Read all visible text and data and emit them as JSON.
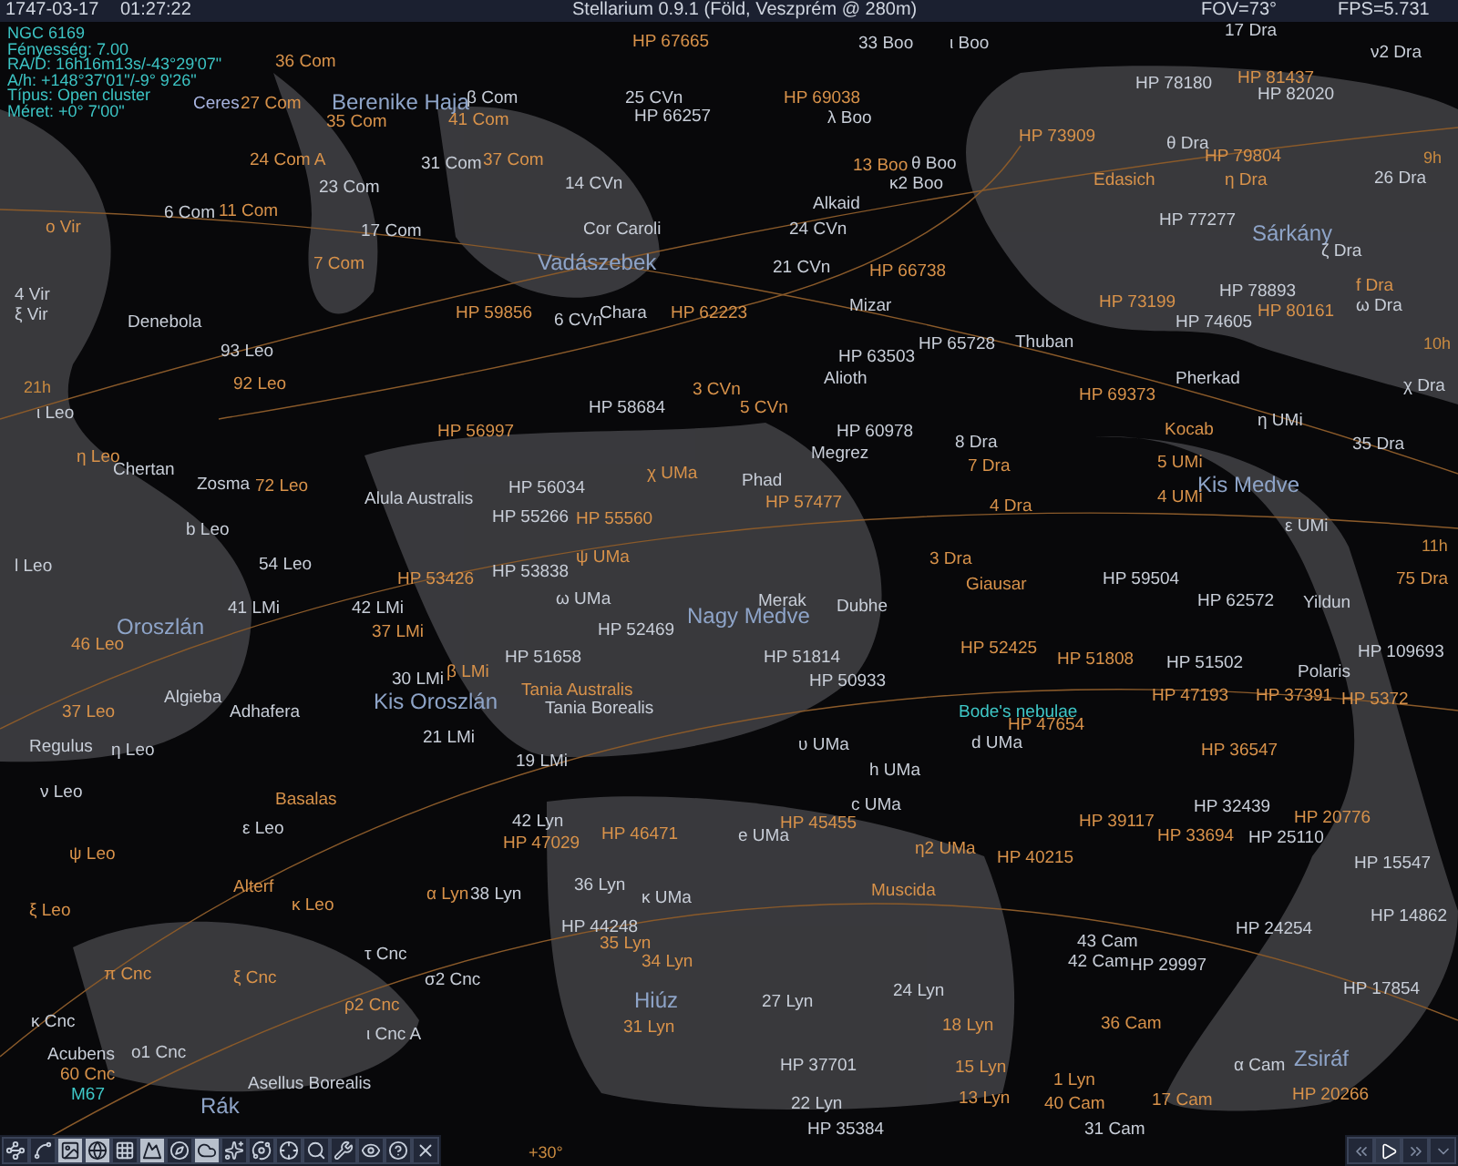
{
  "top_bar": {
    "date": "1747-03-17",
    "time": "01:27:22",
    "title": "Stellarium 0.9.1 (Föld, Veszprém @ 280m)",
    "fov": "FOV=73°",
    "fps": "FPS=5.731"
  },
  "info": [
    "NGC 6169",
    "Fényesség: 7.00",
    "RA/D: 16h16m13s/-43°29'07\"",
    "A/h: +148°37'01\"/-9° 9'26\"",
    "Típus: Open cluster",
    "Méret: +0° 7'00\""
  ],
  "labels": [
    {
      "text": "36 Com",
      "kind": "faint"
    },
    {
      "text": "Ceres",
      "kind": "planet"
    },
    {
      "text": "27 Com",
      "kind": "faint"
    },
    {
      "text": "Berenike Haja",
      "kind": "constellation"
    },
    {
      "text": "35 Com",
      "kind": "faint"
    },
    {
      "text": "β Com",
      "kind": "star"
    },
    {
      "text": "41 Com",
      "kind": "faint"
    },
    {
      "text": "HP 67665",
      "kind": "faint"
    },
    {
      "text": "25 CVn",
      "kind": "star"
    },
    {
      "text": "HP 66257",
      "kind": "star"
    },
    {
      "text": "24 Com A",
      "kind": "faint"
    },
    {
      "text": "31 Com",
      "kind": "star"
    },
    {
      "text": "37 Com",
      "kind": "faint"
    },
    {
      "text": "23 Com",
      "kind": "star"
    },
    {
      "text": "14 CVn",
      "kind": "star"
    },
    {
      "text": "6 Com",
      "kind": "star"
    },
    {
      "text": "11 Com",
      "kind": "faint"
    },
    {
      "text": "o Vir",
      "kind": "faint"
    },
    {
      "text": "17 Com",
      "kind": "star"
    },
    {
      "text": "Cor Caroli",
      "kind": "star"
    },
    {
      "text": "7 Com",
      "kind": "faint"
    },
    {
      "text": "Vadászebek",
      "kind": "constellation"
    },
    {
      "text": "4 Vir",
      "kind": "star"
    },
    {
      "text": "ξ Vir",
      "kind": "star"
    },
    {
      "text": "Denebola",
      "kind": "star"
    },
    {
      "text": "HP 59856",
      "kind": "faint"
    },
    {
      "text": "6 CVn",
      "kind": "star"
    },
    {
      "text": "Chara",
      "kind": "star"
    },
    {
      "text": "HP 62223",
      "kind": "faint"
    },
    {
      "text": "93 Leo",
      "kind": "star"
    },
    {
      "text": "33 Boo",
      "kind": "star"
    },
    {
      "text": "ι Boo",
      "kind": "star"
    },
    {
      "text": "17 Dra",
      "kind": "star"
    },
    {
      "text": "ν2 Dra",
      "kind": "star"
    },
    {
      "text": "HP 69038",
      "kind": "faint"
    },
    {
      "text": "λ Boo",
      "kind": "star"
    },
    {
      "text": "HP 78180",
      "kind": "star"
    },
    {
      "text": "HP 81437",
      "kind": "faint"
    },
    {
      "text": "HP 82020",
      "kind": "star"
    },
    {
      "text": "HP 73909",
      "kind": "faint"
    },
    {
      "text": "θ Dra",
      "kind": "star"
    },
    {
      "text": "HP 79804",
      "kind": "faint"
    },
    {
      "text": "13 Boo",
      "kind": "faint"
    },
    {
      "text": "θ Boo",
      "kind": "star"
    },
    {
      "text": "κ2 Boo",
      "kind": "star"
    },
    {
      "text": "Edasich",
      "kind": "faint"
    },
    {
      "text": "η Dra",
      "kind": "faint"
    },
    {
      "text": "26 Dra",
      "kind": "star"
    },
    {
      "text": "9h",
      "kind": "grid"
    },
    {
      "text": "Alkaid",
      "kind": "star"
    },
    {
      "text": "24 CVn",
      "kind": "star"
    },
    {
      "text": "HP 77277",
      "kind": "star"
    },
    {
      "text": "Sárkány",
      "kind": "constellation"
    },
    {
      "text": "ζ Dra",
      "kind": "star"
    },
    {
      "text": "21 CVn",
      "kind": "star"
    },
    {
      "text": "HP 66738",
      "kind": "faint"
    },
    {
      "text": "Mizar",
      "kind": "star"
    },
    {
      "text": "HP 73199",
      "kind": "faint"
    },
    {
      "text": "HP 78893",
      "kind": "star"
    },
    {
      "text": "f Dra",
      "kind": "faint"
    },
    {
      "text": "HP 80161",
      "kind": "faint"
    },
    {
      "text": "ω Dra",
      "kind": "star"
    },
    {
      "text": "HP 74605",
      "kind": "star"
    },
    {
      "text": "HP 65728",
      "kind": "star"
    },
    {
      "text": "Thuban",
      "kind": "star"
    },
    {
      "text": "HP 63503",
      "kind": "star"
    },
    {
      "text": "10h",
      "kind": "grid"
    },
    {
      "text": "21h",
      "kind": "grid"
    },
    {
      "text": "92 Leo",
      "kind": "faint"
    },
    {
      "text": "ι Leo",
      "kind": "star"
    },
    {
      "text": "HP 58684",
      "kind": "star"
    },
    {
      "text": "3 CVn",
      "kind": "faint"
    },
    {
      "text": "HP 56997",
      "kind": "faint"
    },
    {
      "text": "η Leo",
      "kind": "faint"
    },
    {
      "text": "Chertan",
      "kind": "star"
    },
    {
      "text": "Zosma",
      "kind": "star"
    },
    {
      "text": "72 Leo",
      "kind": "faint"
    },
    {
      "text": "χ UMa",
      "kind": "faint"
    },
    {
      "text": "HP 56034",
      "kind": "star"
    },
    {
      "text": "Alula Australis",
      "kind": "star"
    },
    {
      "text": "HP 55266",
      "kind": "star"
    },
    {
      "text": "HP 55560",
      "kind": "faint"
    },
    {
      "text": "b Leo",
      "kind": "star"
    },
    {
      "text": "l Leo",
      "kind": "star"
    },
    {
      "text": "54 Leo",
      "kind": "star"
    },
    {
      "text": "ψ UMa",
      "kind": "faint"
    },
    {
      "text": "HP 53426",
      "kind": "faint"
    },
    {
      "text": "HP 53838",
      "kind": "star"
    },
    {
      "text": "ω UMa",
      "kind": "star"
    },
    {
      "text": "41 LMi",
      "kind": "star"
    },
    {
      "text": "42 LMi",
      "kind": "star"
    },
    {
      "text": "Oroszlán",
      "kind": "constellation"
    },
    {
      "text": "37 LMi",
      "kind": "faint"
    },
    {
      "text": "HP 52469",
      "kind": "star"
    },
    {
      "text": "Nagy Medve",
      "kind": "constellation"
    },
    {
      "text": "46 Leo",
      "kind": "faint"
    },
    {
      "text": "HP 51658",
      "kind": "star"
    },
    {
      "text": "30 LMi",
      "kind": "star"
    },
    {
      "text": "β LMi",
      "kind": "faint"
    },
    {
      "text": "Tania Australis",
      "kind": "faint"
    },
    {
      "text": "37 Leo",
      "kind": "faint"
    },
    {
      "text": "Algieba",
      "kind": "star"
    },
    {
      "text": "Adhafera",
      "kind": "star"
    },
    {
      "text": "Kis Oroszlán",
      "kind": "constellation"
    },
    {
      "text": "Tania Borealis",
      "kind": "star"
    },
    {
      "text": "Regulus",
      "kind": "star"
    },
    {
      "text": "η Leo",
      "kind": "star"
    },
    {
      "text": "21 LMi",
      "kind": "star"
    },
    {
      "text": "19 LMi",
      "kind": "star"
    },
    {
      "text": "Alioth",
      "kind": "star"
    },
    {
      "text": "5 CVn",
      "kind": "faint"
    },
    {
      "text": "Pherkad",
      "kind": "star"
    },
    {
      "text": "HP 69373",
      "kind": "faint"
    },
    {
      "text": "χ Dra",
      "kind": "star"
    },
    {
      "text": "HP 60978",
      "kind": "star"
    },
    {
      "text": "8 Dra",
      "kind": "star"
    },
    {
      "text": "Kocab",
      "kind": "faint"
    },
    {
      "text": "η UMi",
      "kind": "star"
    },
    {
      "text": "Megrez",
      "kind": "star"
    },
    {
      "text": "7 Dra",
      "kind": "faint"
    },
    {
      "text": "5 UMi",
      "kind": "faint"
    },
    {
      "text": "Kis Medve",
      "kind": "constellation"
    },
    {
      "text": "35 Dra",
      "kind": "star"
    },
    {
      "text": "Phad",
      "kind": "star"
    },
    {
      "text": "HP 57477",
      "kind": "faint"
    },
    {
      "text": "4 UMi",
      "kind": "faint"
    },
    {
      "text": "4 Dra",
      "kind": "faint"
    },
    {
      "text": "ε UMi",
      "kind": "star"
    },
    {
      "text": "11h",
      "kind": "grid"
    },
    {
      "text": "3 Dra",
      "kind": "faint"
    },
    {
      "text": "Giausar",
      "kind": "faint"
    },
    {
      "text": "HP 59504",
      "kind": "star"
    },
    {
      "text": "HP 62572",
      "kind": "star"
    },
    {
      "text": "Yildun",
      "kind": "star"
    },
    {
      "text": "75 Dra",
      "kind": "faint"
    },
    {
      "text": "Merak",
      "kind": "star"
    },
    {
      "text": "Dubhe",
      "kind": "star"
    },
    {
      "text": "HP 51814",
      "kind": "star"
    },
    {
      "text": "HP 52425",
      "kind": "faint"
    },
    {
      "text": "HP 51808",
      "kind": "faint"
    },
    {
      "text": "HP 51502",
      "kind": "star"
    },
    {
      "text": "HP 109693",
      "kind": "star"
    },
    {
      "text": "Polaris",
      "kind": "star"
    },
    {
      "text": "HP 50933",
      "kind": "star"
    },
    {
      "text": "HP 47193",
      "kind": "faint"
    },
    {
      "text": "HP 37391",
      "kind": "faint"
    },
    {
      "text": "HP 5372",
      "kind": "faint"
    },
    {
      "text": "Bode's nebulae",
      "kind": "nebula"
    },
    {
      "text": "HP 47654",
      "kind": "faint"
    },
    {
      "text": "υ UMa",
      "kind": "star"
    },
    {
      "text": "d UMa",
      "kind": "star"
    },
    {
      "text": "HP 36547",
      "kind": "faint"
    },
    {
      "text": "ν Leo",
      "kind": "star"
    },
    {
      "text": "Basalas",
      "kind": "faint"
    },
    {
      "text": "ε Leo",
      "kind": "star"
    },
    {
      "text": "ψ Leo",
      "kind": "faint"
    },
    {
      "text": "Alterf",
      "kind": "faint"
    },
    {
      "text": "ξ Leo",
      "kind": "faint"
    },
    {
      "text": "κ Leo",
      "kind": "faint"
    },
    {
      "text": "42 Lyn",
      "kind": "star"
    },
    {
      "text": "HP 47029",
      "kind": "faint"
    },
    {
      "text": "HP 46471",
      "kind": "faint"
    },
    {
      "text": "α Lyn",
      "kind": "faint"
    },
    {
      "text": "38 Lyn",
      "kind": "star"
    },
    {
      "text": "36 Lyn",
      "kind": "star"
    },
    {
      "text": "κ UMa",
      "kind": "star"
    },
    {
      "text": "HP 44248",
      "kind": "star"
    },
    {
      "text": "τ Cnc",
      "kind": "star"
    },
    {
      "text": "35 Lyn",
      "kind": "faint"
    },
    {
      "text": "34 Lyn",
      "kind": "faint"
    },
    {
      "text": "π Cnc",
      "kind": "faint"
    },
    {
      "text": "ξ Cnc",
      "kind": "faint"
    },
    {
      "text": "σ2 Cnc",
      "kind": "star"
    },
    {
      "text": "ρ2 Cnc",
      "kind": "faint"
    },
    {
      "text": "Hiúz",
      "kind": "constellation"
    },
    {
      "text": "κ Cnc",
      "kind": "star"
    },
    {
      "text": "ι Cnc A",
      "kind": "star"
    },
    {
      "text": "31 Lyn",
      "kind": "faint"
    },
    {
      "text": "Acubens",
      "kind": "star"
    },
    {
      "text": "o1 Cnc",
      "kind": "star"
    },
    {
      "text": "60 Cnc",
      "kind": "faint"
    },
    {
      "text": "M67",
      "kind": "nebula"
    },
    {
      "text": "Asellus Borealis",
      "kind": "star"
    },
    {
      "text": "Rák",
      "kind": "constellation"
    },
    {
      "text": "+30°",
      "kind": "grid"
    },
    {
      "text": "h UMa",
      "kind": "star"
    },
    {
      "text": "c UMa",
      "kind": "star"
    },
    {
      "text": "HP 45455",
      "kind": "faint"
    },
    {
      "text": "e UMa",
      "kind": "star"
    },
    {
      "text": "η2 UMa",
      "kind": "faint"
    },
    {
      "text": "HP 40215",
      "kind": "faint"
    },
    {
      "text": "HP 39117",
      "kind": "faint"
    },
    {
      "text": "HP 32439",
      "kind": "star"
    },
    {
      "text": "HP 20776",
      "kind": "faint"
    },
    {
      "text": "HP 33694",
      "kind": "faint"
    },
    {
      "text": "HP 25110",
      "kind": "star"
    },
    {
      "text": "HP 15547",
      "kind": "star"
    },
    {
      "text": "Muscida",
      "kind": "faint"
    },
    {
      "text": "HP 24254",
      "kind": "star"
    },
    {
      "text": "HP 14862",
      "kind": "star"
    },
    {
      "text": "43 Cam",
      "kind": "star"
    },
    {
      "text": "42 Cam",
      "kind": "star"
    },
    {
      "text": "HP 29997",
      "kind": "star"
    },
    {
      "text": "27 Lyn",
      "kind": "star"
    },
    {
      "text": "24 Lyn",
      "kind": "star"
    },
    {
      "text": "HP 17854",
      "kind": "star"
    },
    {
      "text": "18 Lyn",
      "kind": "faint"
    },
    {
      "text": "36 Cam",
      "kind": "faint"
    },
    {
      "text": "HP 37701",
      "kind": "star"
    },
    {
      "text": "15 Lyn",
      "kind": "faint"
    },
    {
      "text": "1 Lyn",
      "kind": "faint"
    },
    {
      "text": "α Cam",
      "kind": "star"
    },
    {
      "text": "Zsiráf",
      "kind": "constellation"
    },
    {
      "text": "22 Lyn",
      "kind": "star"
    },
    {
      "text": "13 Lyn",
      "kind": "faint"
    },
    {
      "text": "40 Cam",
      "kind": "faint"
    },
    {
      "text": "17 Cam",
      "kind": "faint"
    },
    {
      "text": "HP 20266",
      "kind": "faint"
    },
    {
      "text": "HP 35384",
      "kind": "star"
    },
    {
      "text": "31 Cam",
      "kind": "star"
    }
  ],
  "toolbar": [
    {
      "selected": false
    },
    {
      "selected": false
    },
    {
      "selected": true
    },
    {
      "selected": true
    },
    {
      "selected": false
    },
    {
      "selected": true
    },
    {
      "selected": false
    },
    {
      "selected": true
    },
    {
      "selected": false
    },
    {
      "selected": false
    },
    {
      "selected": false
    },
    {
      "selected": false
    },
    {
      "selected": false
    },
    {
      "selected": false
    },
    {
      "selected": false
    },
    {
      "selected": false
    }
  ],
  "time_controls": [
    {
      "selected": false
    },
    {
      "selected": true
    },
    {
      "selected": false
    },
    {
      "selected": false
    }
  ]
}
